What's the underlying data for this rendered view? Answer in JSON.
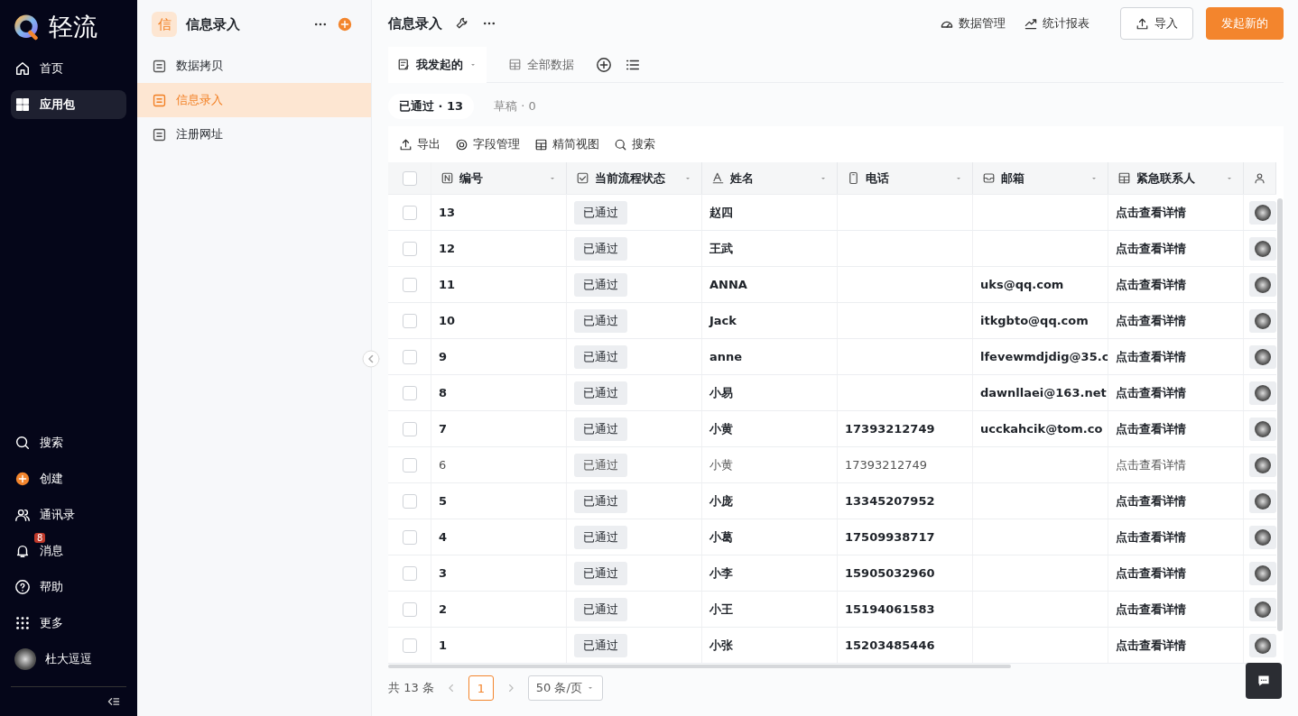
{
  "nav": {
    "logo": "轻流",
    "top_items": [
      {
        "label": "首页",
        "kind": "home",
        "selected": false
      },
      {
        "label": "应用包",
        "kind": "apps",
        "selected": true
      }
    ],
    "bottom_items": [
      {
        "label": "搜索",
        "kind": "search"
      },
      {
        "label": "创建",
        "kind": "create"
      },
      {
        "label": "通讯录",
        "kind": "contacts"
      },
      {
        "label": "消息",
        "kind": "bell",
        "badge": "8"
      },
      {
        "label": "帮助",
        "kind": "help"
      },
      {
        "label": "更多",
        "kind": "grid"
      }
    ],
    "user": "杜大逗逗"
  },
  "panel": {
    "app_icon": "信",
    "title": "信息录入",
    "items": [
      {
        "label": "数据拷贝",
        "selected": false
      },
      {
        "label": "信息录入",
        "selected": true
      },
      {
        "label": "注册网址",
        "selected": false
      }
    ]
  },
  "header": {
    "title": "信息录入",
    "links": [
      {
        "label": "数据管理",
        "kind": "gauge"
      },
      {
        "label": "统计报表",
        "kind": "trend"
      }
    ],
    "import_button": "导入",
    "primary_button": "发起新的"
  },
  "views": [
    {
      "label": "我发起的",
      "kind": "form",
      "selected": true
    },
    {
      "label": "全部数据",
      "kind": "table",
      "selected": false
    }
  ],
  "filters": [
    {
      "label": "已通过 · 13",
      "selected": true
    },
    {
      "label": "草稿 · 0",
      "selected": false
    }
  ],
  "toolbar": [
    {
      "label": "导出",
      "kind": "upload"
    },
    {
      "label": "字段管理",
      "kind": "target"
    },
    {
      "label": "精简视图",
      "kind": "table"
    },
    {
      "label": "搜索",
      "kind": "search"
    }
  ],
  "table": {
    "select_all_checked": false,
    "columns": [
      {
        "label": "编号",
        "kind": "number"
      },
      {
        "label": "当前流程状态",
        "kind": "check"
      },
      {
        "label": "姓名",
        "kind": "text"
      },
      {
        "label": "电话",
        "kind": "phone"
      },
      {
        "label": "邮箱",
        "kind": "mail"
      },
      {
        "label": "紧急联系人",
        "kind": "table"
      },
      {
        "kind": "person"
      }
    ],
    "rows": [
      {
        "number": "13",
        "status": "已通过",
        "name": "赵四",
        "phone": "",
        "email": "",
        "contact": "点击查看详情",
        "dimmed": false,
        "checked": false
      },
      {
        "number": "12",
        "status": "已通过",
        "name": "王武",
        "phone": "",
        "email": "",
        "contact": "点击查看详情",
        "dimmed": false,
        "checked": false
      },
      {
        "number": "11",
        "status": "已通过",
        "name": "ANNA",
        "phone": "",
        "email": "uks@qq.com",
        "contact": "点击查看详情",
        "dimmed": false,
        "checked": false
      },
      {
        "number": "10",
        "status": "已通过",
        "name": "Jack",
        "phone": "",
        "email": "itkgbto@qq.com",
        "contact": "点击查看详情",
        "dimmed": false,
        "checked": false
      },
      {
        "number": "9",
        "status": "已通过",
        "name": "anne",
        "phone": "",
        "email": "lfevewmdjdig@35.c",
        "contact": "点击查看详情",
        "dimmed": false,
        "checked": false
      },
      {
        "number": "8",
        "status": "已通过",
        "name": "小易",
        "phone": "",
        "email": "dawnllaei@163.net",
        "contact": "点击查看详情",
        "dimmed": false,
        "checked": false
      },
      {
        "number": "7",
        "status": "已通过",
        "name": "小黄",
        "phone": "17393212749",
        "email": "ucckahcik@tom.co",
        "contact": "点击查看详情",
        "dimmed": false,
        "checked": false
      },
      {
        "number": "6",
        "status": "已通过",
        "name": "小黄",
        "phone": "17393212749",
        "email": "",
        "contact": "点击查看详情",
        "dimmed": true,
        "checked": false
      },
      {
        "number": "5",
        "status": "已通过",
        "name": "小庞",
        "phone": "13345207952",
        "email": "",
        "contact": "点击查看详情",
        "dimmed": false,
        "checked": false
      },
      {
        "number": "4",
        "status": "已通过",
        "name": "小葛",
        "phone": "17509938717",
        "email": "",
        "contact": "点击查看详情",
        "dimmed": false,
        "checked": false
      },
      {
        "number": "3",
        "status": "已通过",
        "name": "小李",
        "phone": "15905032960",
        "email": "",
        "contact": "点击查看详情",
        "dimmed": false,
        "checked": false
      },
      {
        "number": "2",
        "status": "已通过",
        "name": "小王",
        "phone": "15194061583",
        "email": "",
        "contact": "点击查看详情",
        "dimmed": false,
        "checked": false
      },
      {
        "number": "1",
        "status": "已通过",
        "name": "小张",
        "phone": "15203485446",
        "email": "",
        "contact": "点击查看详情",
        "dimmed": false,
        "checked": false
      }
    ]
  },
  "footer": {
    "total": "共 13 条",
    "page": "1",
    "page_size": "50 条/页"
  }
}
